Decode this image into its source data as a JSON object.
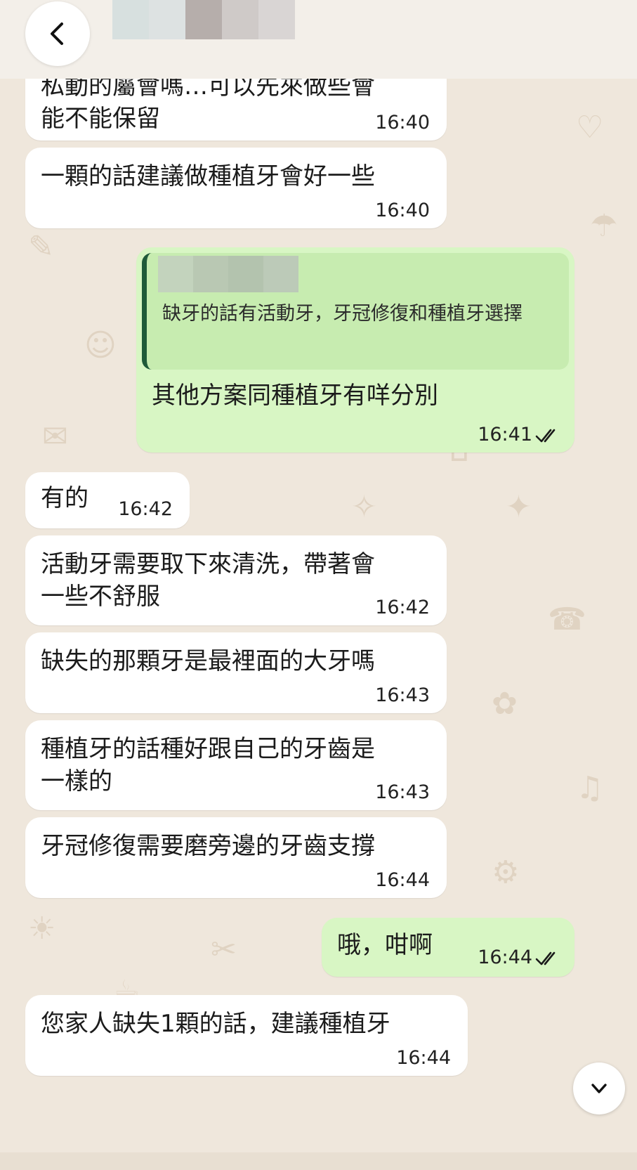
{
  "header": {
    "back_icon": "chevron-left-icon",
    "contact_blurred": true
  },
  "messages": [
    {
      "direction": "in",
      "text": "私動的屬會嗎…可以先來做些會\n能不能保留",
      "time": "16:40"
    },
    {
      "direction": "in",
      "text": "一顆的話建議做種植牙會好一些",
      "time": "16:40"
    },
    {
      "direction": "out",
      "quote_text": "缺牙的話有活動牙，牙冠修復和種植牙選擇",
      "text": "其他方案同種植牙有咩分別",
      "time": "16:41",
      "status_icon": "double-check-icon"
    },
    {
      "direction": "in",
      "text": "有的",
      "time": "16:42"
    },
    {
      "direction": "in",
      "text": "活動牙需要取下來清洗，帶著會\n一些不舒服",
      "time": "16:42"
    },
    {
      "direction": "in",
      "text": "缺失的那顆牙是最裡面的大牙嗎",
      "time": "16:43"
    },
    {
      "direction": "in",
      "text": "種植牙的話種好跟自己的牙齒是\n一樣的",
      "time": "16:43"
    },
    {
      "direction": "in",
      "text": "牙冠修復需要磨旁邊的牙齒支撐",
      "time": "16:44"
    },
    {
      "direction": "out",
      "text": "哦，咁啊",
      "time": "16:44",
      "status_icon": "double-check-icon"
    },
    {
      "direction": "in",
      "text": "您家人缺失1顆的話，建議種植牙",
      "time": "16:44"
    }
  ],
  "scroll_button_icon": "chevron-down-icon",
  "colors": {
    "wallpaper": "#efe7dc",
    "incoming_bubble": "#ffffff",
    "outgoing_bubble": "#d8f6c4",
    "quote_bar": "#1f5a39",
    "read_ticks": "#1b1b1b"
  }
}
